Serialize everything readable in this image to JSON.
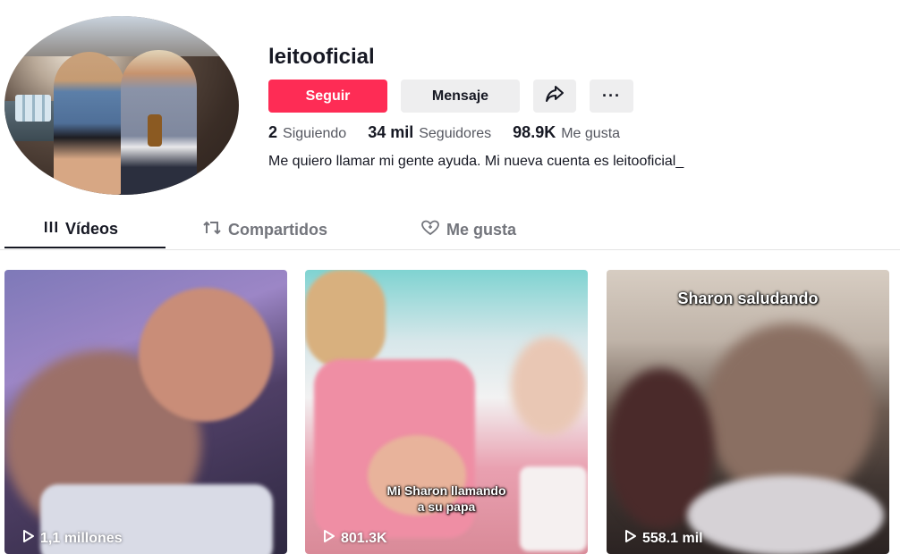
{
  "profile": {
    "username": "leitooficial",
    "follow_label": "Seguir",
    "message_label": "Mensaje",
    "more_label": "···",
    "stats": [
      {
        "value": "2",
        "label": "Siguiendo"
      },
      {
        "value": "34 mil",
        "label": "Seguidores"
      },
      {
        "value": "98.9K",
        "label": "Me gusta"
      }
    ],
    "bio": "Me quiero llamar mi gente ayuda. Mi nueva cuenta es leitooficial_",
    "accent_color": "#fe2c55"
  },
  "tabs": [
    {
      "label": "Vídeos",
      "icon": "grid-icon",
      "active": true
    },
    {
      "label": "Compartidos",
      "icon": "repost-icon",
      "active": false
    },
    {
      "label": "Me gusta",
      "icon": "heart-icon",
      "active": false
    }
  ],
  "videos": [
    {
      "views": "1,1 millones",
      "caption": ""
    },
    {
      "views": "801.3K",
      "caption_line1": "Mi Sharon  llamando",
      "caption_line2": "a su papa"
    },
    {
      "views": "558.1 mil",
      "caption": "Sharon saludando"
    }
  ]
}
